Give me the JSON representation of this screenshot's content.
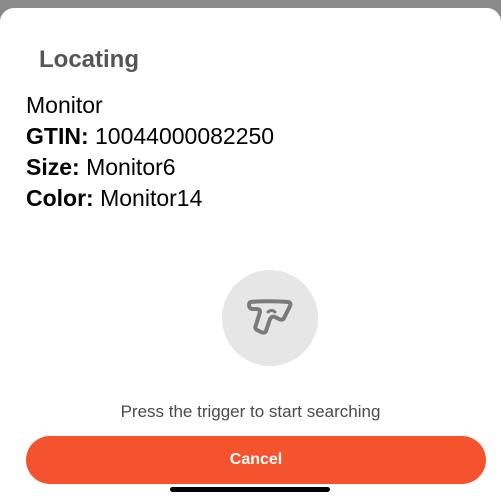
{
  "sheet": {
    "title": "Locating"
  },
  "product": {
    "name": "Monitor",
    "gtin_label": "GTIN:",
    "gtin_value": "10044000082250",
    "size_label": "Size:",
    "size_value": "Monitor6",
    "color_label": "Color:",
    "color_value": "Monitor14"
  },
  "trigger": {
    "icon": "scanner-trigger-icon",
    "hint": "Press the trigger to start searching"
  },
  "actions": {
    "cancel_label": "Cancel"
  },
  "colors": {
    "accent": "#f4532e",
    "title": "#555555",
    "circle": "#e6e6e6"
  }
}
